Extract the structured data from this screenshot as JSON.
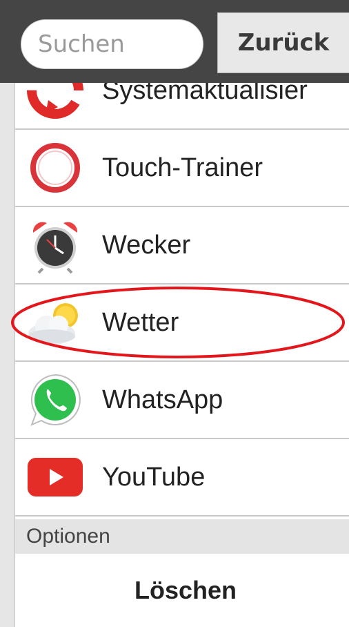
{
  "header": {
    "search": {
      "placeholder": "Suchen",
      "value": ""
    },
    "back_label": "Zurück"
  },
  "apps": [
    {
      "label": "Systemaktualisier",
      "icon": "system-update-icon"
    },
    {
      "label": "Touch-Trainer",
      "icon": "touch-trainer-icon"
    },
    {
      "label": "Wecker",
      "icon": "alarm-clock-icon"
    },
    {
      "label": "Wetter",
      "icon": "weather-icon"
    },
    {
      "label": "WhatsApp",
      "icon": "whatsapp-icon"
    },
    {
      "label": "YouTube",
      "icon": "youtube-icon"
    }
  ],
  "options_label": "Optionen",
  "delete_label": "Löschen",
  "colors": {
    "highlight_ring": "#e3161b",
    "header": "#454545"
  }
}
